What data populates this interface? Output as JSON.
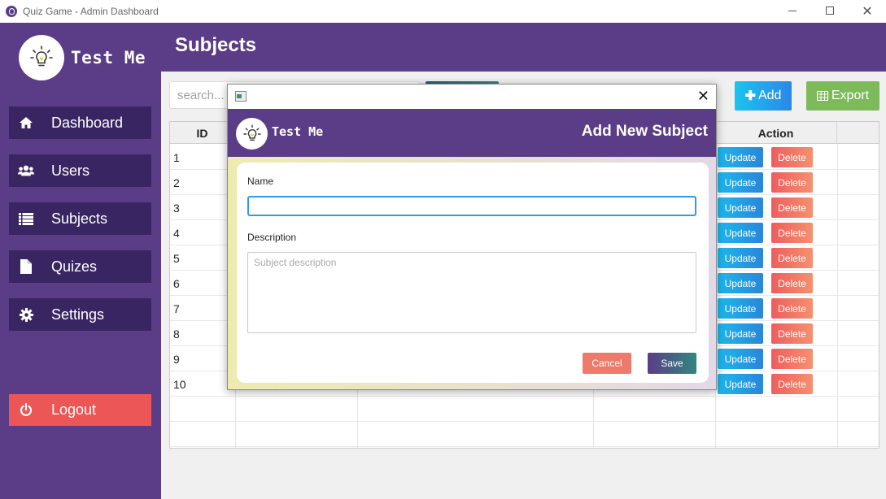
{
  "window": {
    "title": "Quiz Game - Admin Dashboard"
  },
  "brand": {
    "name": "Test Me"
  },
  "sidebar": {
    "items": [
      {
        "label": "Dashboard",
        "icon": "home-icon"
      },
      {
        "label": "Users",
        "icon": "users-icon"
      },
      {
        "label": "Subjects",
        "icon": "list-icon"
      },
      {
        "label": "Quizes",
        "icon": "file-icon"
      },
      {
        "label": "Settings",
        "icon": "gear-icon"
      }
    ],
    "logout_label": "Logout"
  },
  "header": {
    "title": "Subjects"
  },
  "toolbar": {
    "search_placeholder": "search...",
    "add_label": "Add",
    "export_label": "Export"
  },
  "table": {
    "columns": [
      "ID",
      "Action"
    ],
    "rows": [
      {
        "id": "1"
      },
      {
        "id": "2"
      },
      {
        "id": "3"
      },
      {
        "id": "4"
      },
      {
        "id": "5"
      },
      {
        "id": "6"
      },
      {
        "id": "7"
      },
      {
        "id": "8"
      },
      {
        "id": "9"
      },
      {
        "id": "10"
      }
    ],
    "update_label": "Update",
    "delete_label": "Delete"
  },
  "modal": {
    "brand": "Test Me",
    "title": "Add New Subject",
    "name_label": "Name",
    "name_value": "",
    "description_label": "Description",
    "description_placeholder": "Subject description",
    "cancel_label": "Cancel",
    "save_label": "Save"
  },
  "colors": {
    "primary": "#5a3d86",
    "nav_item": "#3a2563",
    "logout": "#ed5656",
    "add": "#1cc3f0",
    "export": "#7dbb5a",
    "update": "#1cb8ee",
    "delete": "#ee5d5d"
  }
}
